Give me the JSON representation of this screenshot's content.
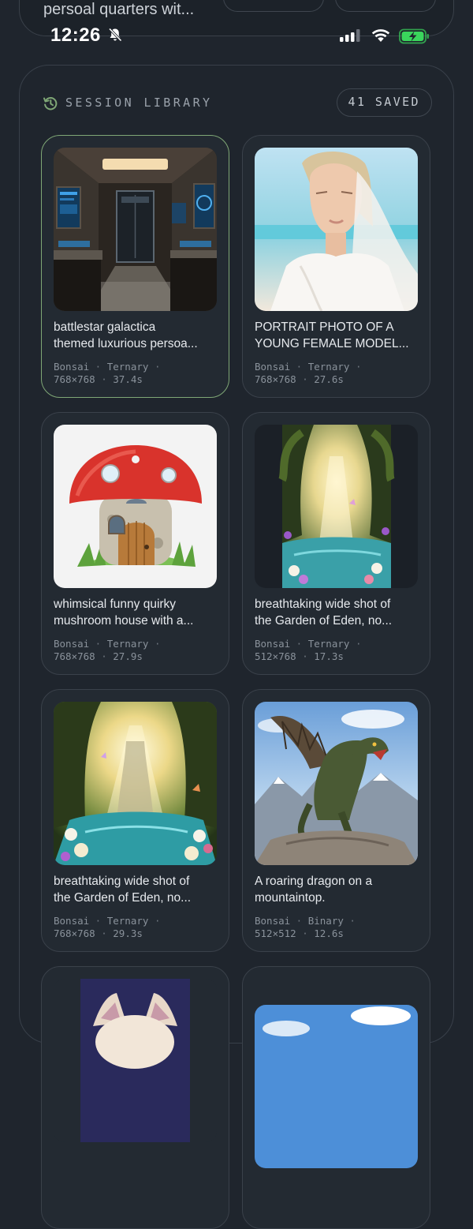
{
  "top_card": {
    "text": "persoal quarters wit..."
  },
  "status_bar": {
    "time": "12:26",
    "icons": [
      "bell-slash-icon",
      "cellular-signal-icon",
      "wifi-icon",
      "battery-charging-icon"
    ],
    "battery_color": "#3ad65c"
  },
  "library": {
    "title": "SESSION LIBRARY",
    "saved_label": "41 SAVED",
    "accent": "#7fa776",
    "cards": [
      {
        "line1": "battlestar galactica",
        "line2": "themed luxurious persoa...",
        "model": "Bonsai",
        "mode": "Ternary",
        "size": "768×768",
        "time": "37.4s",
        "selected": true,
        "image": "spaceship-corridor"
      },
      {
        "line1": "PORTRAIT PHOTO OF A",
        "line2": "YOUNG FEMALE MODEL...",
        "model": "Bonsai",
        "mode": "Ternary",
        "size": "768×768",
        "time": "27.6s",
        "selected": false,
        "image": "portrait-woman"
      },
      {
        "line1": "whimsical funny quirky",
        "line2": "mushroom house with a...",
        "model": "Bonsai",
        "mode": "Ternary",
        "size": "768×768",
        "time": "27.9s",
        "selected": false,
        "image": "mushroom-house"
      },
      {
        "line1": "breathtaking wide shot of",
        "line2": "the Garden of Eden, no...",
        "model": "Bonsai",
        "mode": "Ternary",
        "size": "512×768",
        "time": "17.3s",
        "selected": false,
        "image": "garden-of-eden-portrait"
      },
      {
        "line1": "breathtaking wide shot of",
        "line2": "the Garden of Eden, no...",
        "model": "Bonsai",
        "mode": "Ternary",
        "size": "768×768",
        "time": "29.3s",
        "selected": false,
        "image": "garden-of-eden-square"
      },
      {
        "line1": "A roaring dragon on a",
        "line2": "mountaintop.",
        "model": "Bonsai",
        "mode": "Binary",
        "size": "512×512",
        "time": "12.6s",
        "selected": false,
        "image": "dragon-mountain"
      },
      {
        "line1": "",
        "line2": "",
        "model": "",
        "mode": "",
        "size": "",
        "time": "",
        "selected": false,
        "image": "creature-dark"
      },
      {
        "line1": "",
        "line2": "",
        "model": "",
        "mode": "",
        "size": "",
        "time": "",
        "selected": false,
        "image": "sky-landscape"
      }
    ]
  }
}
